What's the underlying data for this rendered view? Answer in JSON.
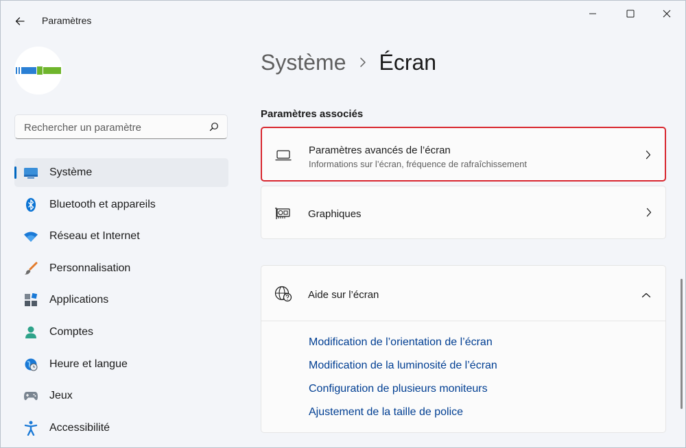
{
  "window": {
    "title": "Paramètres"
  },
  "sidebar": {
    "search": {
      "placeholder": "Rechercher un paramètre"
    },
    "items": [
      {
        "label": "Système",
        "icon": "monitor-icon",
        "active": true
      },
      {
        "label": "Bluetooth et appareils",
        "icon": "bluetooth-icon"
      },
      {
        "label": "Réseau et Internet",
        "icon": "wifi-icon"
      },
      {
        "label": "Personnalisation",
        "icon": "paintbrush-icon"
      },
      {
        "label": "Applications",
        "icon": "apps-icon"
      },
      {
        "label": "Comptes",
        "icon": "account-icon"
      },
      {
        "label": "Heure et langue",
        "icon": "globe-clock-icon"
      },
      {
        "label": "Jeux",
        "icon": "gamepad-icon"
      },
      {
        "label": "Accessibilité",
        "icon": "accessibility-icon"
      }
    ]
  },
  "breadcrumb": {
    "parent": "Système",
    "current": "Écran"
  },
  "related": {
    "heading": "Paramètres associés",
    "cards": [
      {
        "title": "Paramètres avancés de l’écran",
        "subtitle": "Informations sur l’écran, fréquence de rafraîchissement",
        "icon": "laptop-icon",
        "highlighted": true
      },
      {
        "title": "Graphiques",
        "icon": "graphics-card-icon"
      }
    ]
  },
  "help": {
    "title": "Aide sur l’écran",
    "icon": "web-help-icon",
    "links": [
      "Modification de l’orientation de l’écran",
      "Modification de la luminosité de l’écran",
      "Configuration de plusieurs moniteurs",
      "Ajustement de la taille de police"
    ]
  },
  "colors": {
    "accent": "#0067c0",
    "link": "#003e92",
    "highlight_border": "#d8262e"
  }
}
